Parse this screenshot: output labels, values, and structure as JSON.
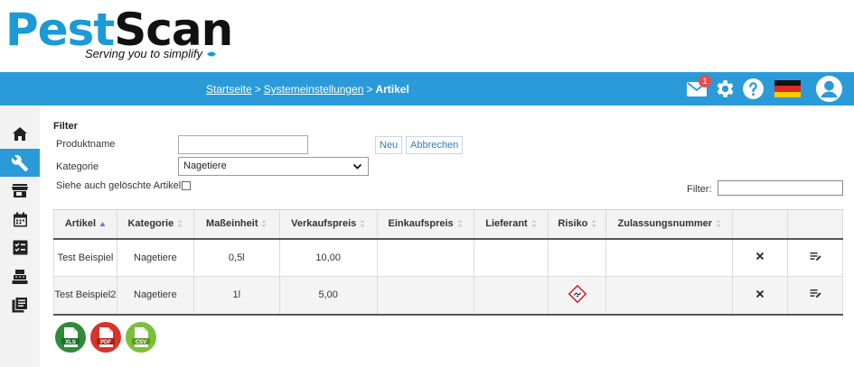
{
  "logo": {
    "brand_part1": "Pest",
    "brand_part2": "Scan",
    "tagline": "Serving you to simplify"
  },
  "breadcrumb": {
    "home": "Startseite",
    "settings": "Systemeinstellungen",
    "current": "Artikel",
    "separator": ">"
  },
  "header": {
    "mail_badge": "1"
  },
  "filter": {
    "title": "Filter",
    "product_label": "Produktname",
    "product_value": "",
    "new_button": "Neu",
    "cancel_button": "Abbrechen",
    "category_label": "Kategorie",
    "category_value": "Nagetiere",
    "deleted_label": "Siehe auch gelöschte Artikel",
    "search_label": "Filter:",
    "search_value": ""
  },
  "table": {
    "headers": [
      "Artikel",
      "Kategorie",
      "Maßeinheit",
      "Verkaufspreis",
      "Einkaufspreis",
      "Lieferant",
      "Risiko",
      "Zulassungsnummer",
      "",
      ""
    ],
    "rows": [
      {
        "article": "Test Beispiel",
        "category": "Nagetiere",
        "unit": "0,5l",
        "sale_price": "10,00",
        "purchase_price": "",
        "supplier": "",
        "risk_icon": "",
        "approval_no": ""
      },
      {
        "article": "Test Beispiel2",
        "category": "Nagetiere",
        "unit": "1l",
        "sale_price": "5,00",
        "purchase_price": "",
        "supplier": "",
        "risk_icon": "ghs-hazard-icon",
        "approval_no": ""
      }
    ]
  },
  "exports": {
    "xls": "XLS",
    "pdf": "PDF",
    "csv": "CSV"
  },
  "colors": {
    "accent": "#2b9ad9",
    "xls": "#2e8b3a",
    "pdf": "#d9332b",
    "csv": "#7cbf3a"
  }
}
